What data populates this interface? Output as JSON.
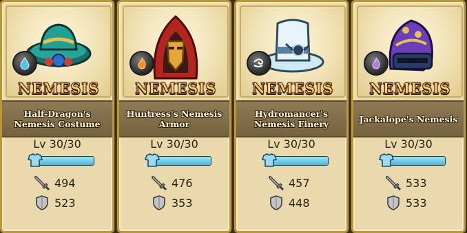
{
  "cards": [
    {
      "badge": "NEMESIS",
      "name": "Half-Dragon's Nemesis Costume",
      "level": "Lv 30/30",
      "xp_fraction": 1.0,
      "attack": "494",
      "defense": "523",
      "element_icon": "water-drop-icon",
      "item_icon": "hat-icon"
    },
    {
      "badge": "NEMESIS",
      "name": "Huntress's Nemesis Armor",
      "level": "Lv 30/30",
      "xp_fraction": 1.0,
      "attack": "476",
      "defense": "353",
      "element_icon": "fire-icon",
      "item_icon": "hooded-mask-icon"
    },
    {
      "badge": "NEMESIS",
      "name": "Hydromancer's Nemesis Finery",
      "level": "Lv 30/30",
      "xp_fraction": 1.0,
      "attack": "457",
      "defense": "448",
      "element_icon": "wind-icon",
      "item_icon": "top-hat-icon"
    },
    {
      "badge": "NEMESIS",
      "name": "Jackalope's Nemesis",
      "level": "Lv 30/30",
      "xp_fraction": 1.0,
      "attack": "533",
      "defense": "533",
      "element_icon": "shadow-flame-icon",
      "item_icon": "purple-helmet-icon"
    }
  ],
  "colors": {
    "card_bg": "#e9d9ad",
    "namebar_bg": "#8e7b55",
    "nemesis_text": "#ffd56a",
    "xp_fill": "#49b8d6",
    "water": "#4fc3e8",
    "fire": "#ff8a1c",
    "wind": "#ffffff",
    "shadow": "#b07be6"
  }
}
